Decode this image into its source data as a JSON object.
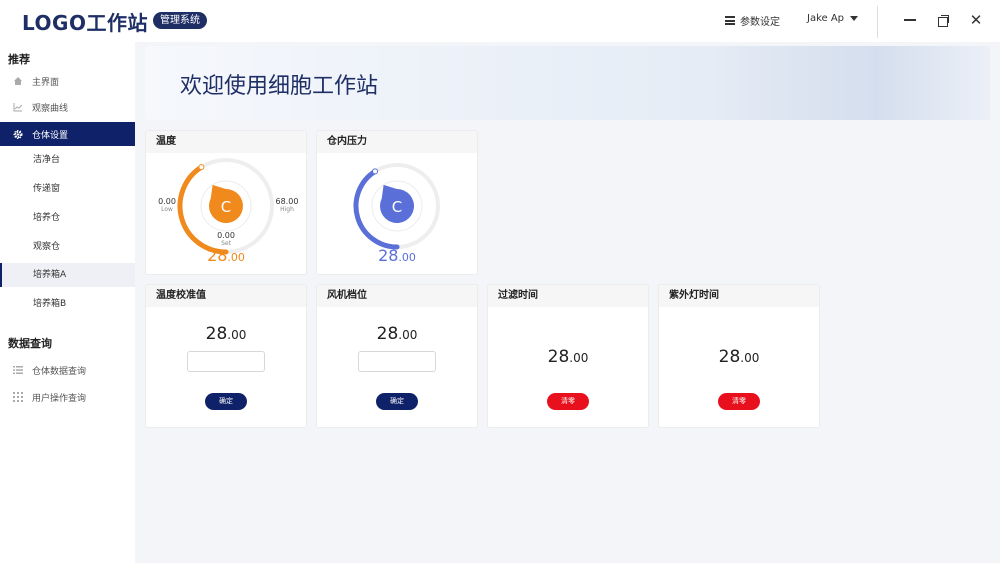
{
  "header": {
    "logo": "LOGO工作站",
    "badge": "管理系统",
    "settings_label": "参数设定",
    "user_name": "Jake Ap"
  },
  "sidebar": {
    "section1_title": "推荐",
    "items": [
      {
        "label": "主界面",
        "icon": "home-icon"
      },
      {
        "label": "观察曲线",
        "icon": "chart-icon"
      },
      {
        "label": "仓体设置",
        "icon": "gear-icon"
      }
    ],
    "subitems": [
      "洁净台",
      "传递窗",
      "培养仓",
      "观察仓",
      "培养箱A",
      "培养箱B"
    ],
    "selected_subitem": "培养箱A",
    "section2_title": "数据查询",
    "query_items": [
      {
        "label": "仓体数据查询",
        "icon": "list-icon"
      },
      {
        "label": "用户操作查询",
        "icon": "grid-icon"
      }
    ]
  },
  "banner": {
    "title": "欢迎使用细胞工作站"
  },
  "gauges": {
    "temperature": {
      "title": "温度",
      "low": "0.00",
      "low_label": "Low",
      "high": "68.00",
      "high_label": "High",
      "set": "0.00",
      "set_label": "Set",
      "value_int": "28",
      "value_dec": ".00",
      "unit_letter": "C",
      "level": 0.41,
      "color": "#f08a1c"
    },
    "pressure": {
      "title": "仓内压力",
      "value_int": "28",
      "value_dec": ".00",
      "unit_letter": "C",
      "level": 0.41,
      "color": "#5a6fd8"
    }
  },
  "cards": {
    "temp_calibration": {
      "title": "温度校准值",
      "value_int": "28",
      "value_dec": ".00",
      "button": "确定"
    },
    "fan_level": {
      "title": "风机档位",
      "value_int": "28",
      "value_dec": ".00",
      "button": "确定"
    },
    "filter_time": {
      "title": "过滤时间",
      "value_int": "28",
      "value_dec": ".00",
      "button": "清零"
    },
    "uv_time": {
      "title": "紫外灯时间",
      "value_int": "28",
      "value_dec": ".00",
      "button": "清零"
    }
  },
  "colors": {
    "navy": "#0f2168",
    "red": "#e8101d",
    "orange": "#f08a1c",
    "blue": "#5a6fd8"
  }
}
